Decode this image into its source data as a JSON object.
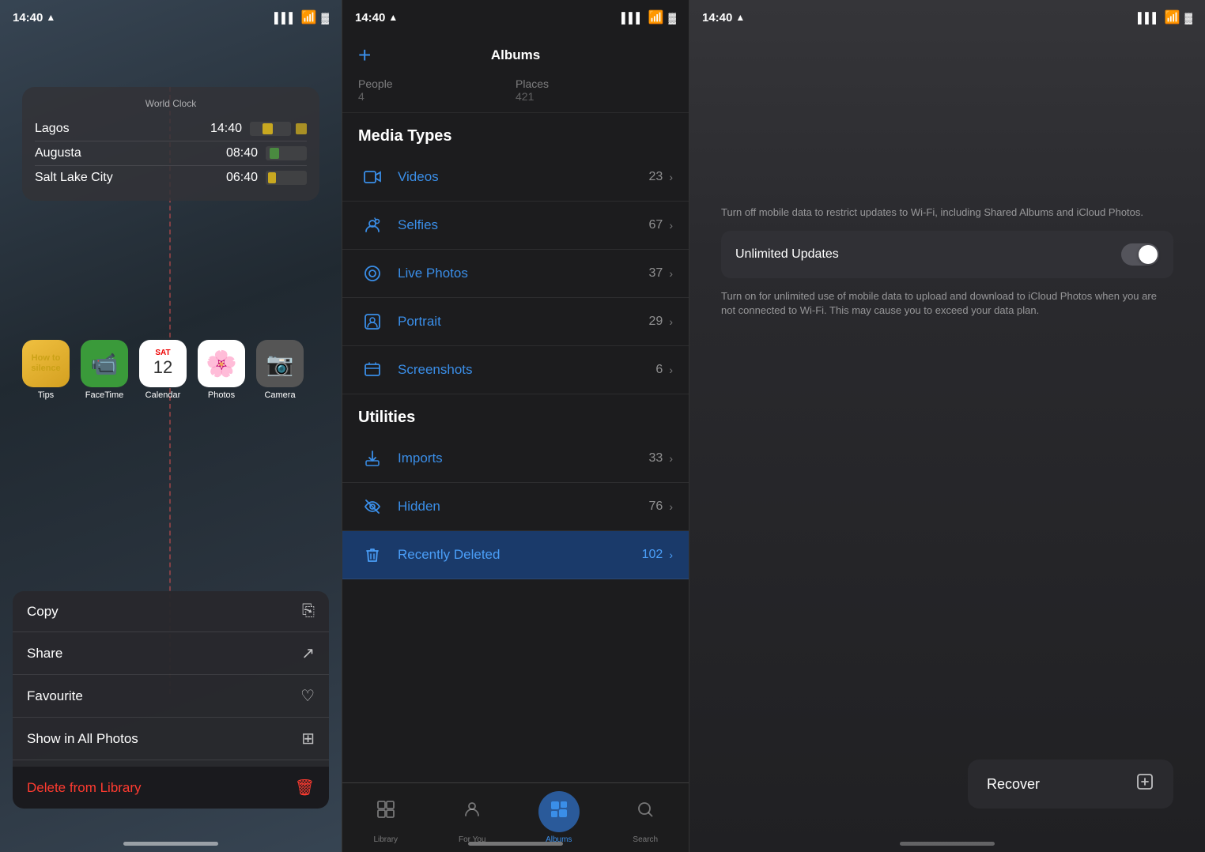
{
  "panel1": {
    "status": {
      "time": "14:40",
      "location_icon": "▲",
      "signal": "▌▌▌",
      "wifi": "wifi",
      "battery": "battery"
    },
    "widget": {
      "title": "World Clock",
      "clocks": [
        {
          "city": "Lagos",
          "time": "14:40",
          "bar_offset": "30%",
          "bar_width": "25%"
        },
        {
          "city": "Augusta",
          "time": "08:40",
          "bar_offset": "10%",
          "bar_width": "20%"
        },
        {
          "city": "Salt Lake City",
          "time": "06:40",
          "bar_offset": "5%",
          "bar_width": "18%"
        }
      ]
    },
    "apps": [
      {
        "name": "Tips",
        "label": "Tips"
      },
      {
        "name": "FaceTime",
        "label": "FaceTime"
      },
      {
        "name": "Calendar",
        "label": "Calendar"
      },
      {
        "name": "Photos",
        "label": "Photos"
      },
      {
        "name": "Camera",
        "label": "Camera"
      }
    ],
    "context_menu": {
      "items": [
        {
          "label": "Copy",
          "icon": "⎘"
        },
        {
          "label": "Share",
          "icon": "↗"
        },
        {
          "label": "Favourite",
          "icon": "♡"
        },
        {
          "label": "Show in All Photos",
          "icon": "⊞"
        }
      ],
      "delete_label": "Delete from Library",
      "delete_icon": "🗑"
    }
  },
  "panel2": {
    "status": {
      "time": "14:40"
    },
    "header": {
      "add_label": "+",
      "title": "Albums"
    },
    "people_row": {
      "label1": "People",
      "count1": "4",
      "label2": "Places",
      "count2": "421"
    },
    "media_types": {
      "heading": "Media Types",
      "items": [
        {
          "icon": "video",
          "name": "Videos",
          "count": "23"
        },
        {
          "icon": "selfie",
          "name": "Selfies",
          "count": "67"
        },
        {
          "icon": "live",
          "name": "Live Photos",
          "count": "37"
        },
        {
          "icon": "portrait",
          "name": "Portrait",
          "count": "29"
        },
        {
          "icon": "screenshot",
          "name": "Screenshots",
          "count": "6"
        }
      ]
    },
    "utilities": {
      "heading": "Utilities",
      "items": [
        {
          "icon": "import",
          "name": "Imports",
          "count": "33"
        },
        {
          "icon": "hidden",
          "name": "Hidden",
          "count": "76"
        },
        {
          "icon": "trash",
          "name": "Recently Deleted",
          "count": "102",
          "selected": true
        }
      ]
    },
    "tabs": [
      {
        "id": "library",
        "label": "Library",
        "active": false
      },
      {
        "id": "for_you",
        "label": "For You",
        "active": false
      },
      {
        "id": "albums",
        "label": "Albums",
        "active": true
      },
      {
        "id": "search",
        "label": "Search",
        "active": false
      }
    ]
  },
  "panel3": {
    "status": {
      "time": "14:40"
    },
    "settings": {
      "description1": "Turn off mobile data to restrict updates to Wi-Fi, including Shared Albums and iCloud Photos.",
      "unlimited_label": "Unlimited Updates",
      "description2": "Turn on for unlimited use of mobile data to upload and download to iCloud Photos when you are not connected to Wi-Fi. This may cause you to exceed your data plan."
    },
    "recover_button": {
      "label": "Recover",
      "icon": "⎘"
    }
  }
}
